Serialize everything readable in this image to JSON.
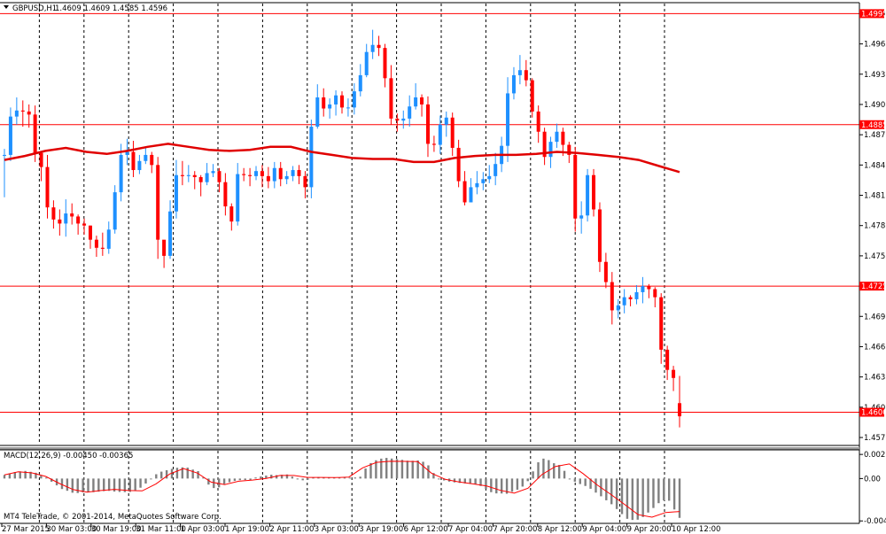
{
  "header": {
    "symbol_label": "GBPUSD,H1",
    "ohlc_label": "1.4609 1.4609 1.4585 1.4596"
  },
  "macd_header": {
    "label": "MACD(12,26,9) -0.00450 -0.00365"
  },
  "copyright": "MT4 TeleTrade, © 2001-2014, MetaQuotes Software Corp.",
  "colors": {
    "bull": "#1e90ff",
    "bear": "#ff0000",
    "ma": "#e00000",
    "hline": "#ff0000",
    "grid": "#000000",
    "hist": "#808080",
    "signal": "#ff0000"
  },
  "chart_data": [
    {
      "type": "candlestick",
      "title": "GBPUSD,H1",
      "timeframe": "H1",
      "grid": true,
      "y_axis_ticks": [
        "1.4995",
        "1.4965",
        "1.4935",
        "1.4905",
        "1.4875",
        "1.4845",
        "1.4815",
        "1.4785",
        "1.4755",
        "1.4725",
        "1.4695",
        "1.4665",
        "1.4635",
        "1.4605",
        "1.4575"
      ],
      "ylim": [
        1.4568,
        1.5005
      ],
      "x_axis_labels": [
        "27 Mar 2015",
        "30 Mar 03:00",
        "30 Mar 19:00",
        "31 Mar 11:00",
        "1 Apr 03:00",
        "1 Apr 19:00",
        "2 Apr 11:00",
        "3 Apr 03:00",
        "3 Apr 19:00",
        "6 Apr 12:00",
        "7 Apr 04:00",
        "7 Apr 20:00",
        "8 Apr 12:00",
        "9 Apr 04:00",
        "9 Apr 20:00",
        "10 Apr 12:00"
      ],
      "horizontal_lines": [
        {
          "label": "1.4995",
          "value": 1.4995
        },
        {
          "label": "1.4885",
          "value": 1.4885
        },
        {
          "label": "1.4725",
          "value": 1.4725
        },
        {
          "label": "1.4600",
          "value": 1.46
        }
      ],
      "series": [
        {
          "name": "GBPUSD",
          "candles_close": [
            1.4855,
            1.4893,
            1.4899,
            1.4898,
            1.4895,
            1.4857,
            1.4843,
            1.4803,
            1.4791,
            1.4787,
            1.4797,
            1.4794,
            1.4787,
            1.4785,
            1.4771,
            1.4763,
            1.4762,
            1.4781,
            1.4818,
            1.4855,
            1.4858,
            1.484,
            1.4849,
            1.4855,
            1.4845,
            1.4771,
            1.4755,
            1.4799,
            1.4835,
            1.4834,
            1.4835,
            1.4833,
            1.4828,
            1.4837,
            1.4839,
            1.4828,
            1.4804,
            1.4789,
            1.4836,
            1.4835,
            1.4834,
            1.4839,
            1.4834,
            1.4829,
            1.4842,
            1.4831,
            1.4834,
            1.484,
            1.4834,
            1.4823,
            1.4883,
            1.4912,
            1.4901,
            1.4905,
            1.4914,
            1.4902,
            1.4902,
            1.4918,
            1.4934,
            1.4957,
            1.4964,
            1.4961,
            1.4931,
            1.4891,
            1.4889,
            1.4891,
            1.4903,
            1.4912,
            1.4905,
            1.4866,
            1.4865,
            1.4885,
            1.4892,
            1.4862,
            1.4829,
            1.4808,
            1.4823,
            1.4827,
            1.4831,
            1.4834,
            1.4846,
            1.4864,
            1.4916,
            1.4934,
            1.4939,
            1.4929,
            1.4898,
            1.4878,
            1.4853,
            1.4868,
            1.4878,
            1.4865,
            1.4855,
            1.4792,
            1.4795,
            1.4835,
            1.4801,
            1.4749,
            1.4729,
            1.4701,
            1.4706,
            1.4714,
            1.4712,
            1.4719,
            1.4725,
            1.4722,
            1.4714,
            1.4662,
            1.4642,
            1.4634,
            1.4596
          ],
          "candles_range": [
            [
              1.4813,
              1.4861
            ],
            [
              1.4849,
              1.4902
            ],
            [
              1.4885,
              1.4912
            ],
            [
              1.4883,
              1.4909
            ],
            [
              1.4882,
              1.4905
            ],
            [
              1.4848,
              1.4904
            ],
            [
              1.4829,
              1.4858
            ],
            [
              1.4792,
              1.4855
            ],
            [
              1.4782,
              1.481
            ],
            [
              1.4775,
              1.4801
            ],
            [
              1.4774,
              1.4811
            ],
            [
              1.4786,
              1.4807
            ],
            [
              1.4776,
              1.4796
            ],
            [
              1.4776,
              1.4792
            ],
            [
              1.4762,
              1.4785
            ],
            [
              1.4754,
              1.4775
            ],
            [
              1.4755,
              1.4778
            ],
            [
              1.4757,
              1.4789
            ],
            [
              1.4777,
              1.4825
            ],
            [
              1.4809,
              1.4866
            ],
            [
              1.4845,
              1.4871
            ],
            [
              1.4833,
              1.4869
            ],
            [
              1.4836,
              1.4855
            ],
            [
              1.4846,
              1.4863
            ],
            [
              1.4837,
              1.4858
            ],
            [
              1.4752,
              1.4853
            ],
            [
              1.4743,
              1.4769
            ],
            [
              1.4752,
              1.481
            ],
            [
              1.4792,
              1.485
            ],
            [
              1.4825,
              1.4849
            ],
            [
              1.4828,
              1.4845
            ],
            [
              1.4821,
              1.4839
            ],
            [
              1.4814,
              1.4835
            ],
            [
              1.4825,
              1.4847
            ],
            [
              1.4833,
              1.4846
            ],
            [
              1.4818,
              1.4842
            ],
            [
              1.4795,
              1.4837
            ],
            [
              1.478,
              1.4807
            ],
            [
              1.4785,
              1.4847
            ],
            [
              1.4829,
              1.4842
            ],
            [
              1.4824,
              1.4842
            ],
            [
              1.483,
              1.4844
            ],
            [
              1.4823,
              1.4845
            ],
            [
              1.4822,
              1.4843
            ],
            [
              1.4822,
              1.4848
            ],
            [
              1.4824,
              1.4848
            ],
            [
              1.4826,
              1.4839
            ],
            [
              1.4829,
              1.4844
            ],
            [
              1.4826,
              1.4845
            ],
            [
              1.4812,
              1.4839
            ],
            [
              1.4812,
              1.489
            ],
            [
              1.4881,
              1.4925
            ],
            [
              1.4893,
              1.4921
            ],
            [
              1.4891,
              1.4911
            ],
            [
              1.4894,
              1.4919
            ],
            [
              1.4896,
              1.4918
            ],
            [
              1.4893,
              1.4911
            ],
            [
              1.4895,
              1.4926
            ],
            [
              1.4913,
              1.4945
            ],
            [
              1.4932,
              1.4965
            ],
            [
              1.495,
              1.4979
            ],
            [
              1.4953,
              1.4973
            ],
            [
              1.4922,
              1.4965
            ],
            [
              1.4885,
              1.4944
            ],
            [
              1.4878,
              1.4896
            ],
            [
              1.4881,
              1.4899
            ],
            [
              1.4883,
              1.4914
            ],
            [
              1.49,
              1.4926
            ],
            [
              1.4893,
              1.4915
            ],
            [
              1.4853,
              1.4913
            ],
            [
              1.4858,
              1.4874
            ],
            [
              1.4856,
              1.4894
            ],
            [
              1.4873,
              1.4898
            ],
            [
              1.4854,
              1.4897
            ],
            [
              1.4823,
              1.487
            ],
            [
              1.4805,
              1.4839
            ],
            [
              1.4813,
              1.4832
            ],
            [
              1.4816,
              1.4839
            ],
            [
              1.482,
              1.4838
            ],
            [
              1.4827,
              1.4845
            ],
            [
              1.4825,
              1.4857
            ],
            [
              1.4838,
              1.4873
            ],
            [
              1.4848,
              1.4932
            ],
            [
              1.491,
              1.4942
            ],
            [
              1.4925,
              1.4954
            ],
            [
              1.4923,
              1.4949
            ],
            [
              1.4892,
              1.4931
            ],
            [
              1.4867,
              1.4904
            ],
            [
              1.4845,
              1.4882
            ],
            [
              1.4842,
              1.4873
            ],
            [
              1.4862,
              1.4886
            ],
            [
              1.4854,
              1.4882
            ],
            [
              1.4847,
              1.4868
            ],
            [
              1.4779,
              1.4863
            ],
            [
              1.4777,
              1.4809
            ],
            [
              1.4789,
              1.4841
            ],
            [
              1.4794,
              1.4841
            ],
            [
              1.4739,
              1.4808
            ],
            [
              1.4723,
              1.4758
            ],
            [
              1.4687,
              1.4739
            ],
            [
              1.4693,
              1.4712
            ],
            [
              1.4698,
              1.4722
            ],
            [
              1.4705,
              1.4716
            ],
            [
              1.4707,
              1.4726
            ],
            [
              1.4708,
              1.4734
            ],
            [
              1.4713,
              1.4727
            ],
            [
              1.4704,
              1.4724
            ],
            [
              1.4648,
              1.4718
            ],
            [
              1.4632,
              1.4666
            ],
            [
              1.4621,
              1.4646
            ],
            [
              1.4585,
              1.4636
            ]
          ],
          "last_candle_ohlc": [
            1.4609,
            1.4609,
            1.4585,
            1.4596
          ]
        },
        {
          "name": "moving average",
          "values": [
            1.485,
            1.4854,
            1.4859,
            1.4862,
            1.4858,
            1.4856,
            1.4859,
            1.4863,
            1.4866,
            1.4863,
            1.486,
            1.4859,
            1.486,
            1.4863,
            1.4863,
            1.4858,
            1.4855,
            1.4852,
            1.4851,
            1.4851,
            1.4848,
            1.4848,
            1.4852,
            1.4854,
            1.4855,
            1.4855,
            1.4856,
            1.4858,
            1.4857,
            1.4855,
            1.4853,
            1.485,
            1.4844,
            1.4838
          ]
        }
      ]
    },
    {
      "type": "bar+line",
      "title": "MACD(12,26,9) -0.00450 -0.00365",
      "indicator": "MACD",
      "parameters": [
        12,
        26,
        9
      ],
      "grid": true,
      "y_axis_ticks": [
        "0.00276",
        "0.00",
        "-0.00485"
      ],
      "ylim": [
        -0.00503,
        0.00318
      ],
      "series": [
        {
          "name": "MACD",
          "values": [
            0.00041,
            0.00059,
            0.00074,
            0.00082,
            0.00087,
            0.00077,
            0.00066,
            0.00032,
            0.00011,
            -0.00036,
            -0.00078,
            -0.0012,
            -0.0014,
            -0.00162,
            -0.00166,
            -0.00158,
            -0.00159,
            -0.00156,
            -0.0015,
            -0.00144,
            -0.00141,
            -0.00149,
            -0.00153,
            -0.00155,
            -0.00153,
            -0.00134,
            -0.00105,
            -0.00057,
            -9e-05,
            0.00049,
            0.00079,
            0.00095,
            0.00111,
            0.00123,
            0.00128,
            0.00125,
            0.00103,
            0.00085,
            0.00012,
            -0.00069,
            -0.00109,
            -0.00101,
            -0.00062,
            -0.00042,
            -0.00027,
            -0.00018,
            -0.00017,
            -0.00017,
            0.00012,
            0.00024,
            0.00034,
            0.00044,
            0.00039,
            0.00043,
            0.00047,
            0.00022,
            -4e-05,
            -0.0002,
            -0.00012,
            0.00013,
            0.00017,
            0.00011,
            0.00012,
            0.00014,
            0.00013,
            0.00012,
            0.00011,
            0.00012,
            0.00021,
            0.00115,
            0.00177,
            0.00209,
            0.00228,
            0.00236,
            0.00229,
            0.00223,
            0.00214,
            0.00204,
            0.00203,
            0.00207,
            0.00192,
            0.00151,
            0.00063,
            -3e-05,
            -0.00022,
            -0.00035,
            -0.00044,
            -0.0005,
            -0.00056,
            -0.0006,
            -0.00068,
            -0.00085,
            -0.00118,
            -0.00156,
            -0.0017,
            -0.00171,
            -0.00174,
            -0.00151,
            -0.00128,
            -0.00092,
            -0.0003,
            0.00082,
            0.00186,
            0.00228,
            0.00211,
            0.00175,
            0.00155,
            0.00088,
            -9e-05,
            -0.00036,
            -0.00063,
            -0.00085,
            -0.00117,
            -0.00161,
            -0.00203,
            -0.00249,
            -0.00294,
            -0.00349,
            -0.00407,
            -0.00461,
            -0.00474,
            -0.00471,
            -0.0044,
            -0.00389,
            -0.00337,
            -0.00282,
            -0.0025,
            -0.00254,
            -0.00354,
            -0.0045
          ]
        },
        {
          "name": "signal",
          "values": [
            0.00042,
            0.00077,
            0.00065,
            0.00024,
            -0.00057,
            -0.00127,
            -0.00156,
            -0.00137,
            -0.00124,
            -0.00137,
            -0.00141,
            -0.00061,
            0.00052,
            0.00114,
            0.00063,
            -0.00041,
            -0.00069,
            -0.00031,
            -0.00018,
            2e-05,
            0.00035,
            0.00035,
            0.00013,
            0.00013,
            0.00011,
            0.00017,
            0.00122,
            0.00185,
            0.00197,
            0.00196,
            0.00194,
            0.00061,
            -9e-05,
            -0.0004,
            -0.00061,
            -0.00085,
            -0.00135,
            -0.00168,
            -0.00111,
            0.00044,
            0.00139,
            0.00167,
            0.00056,
            -0.00071,
            -0.0018,
            -0.00295,
            -0.00414,
            -0.00442,
            -0.00388,
            -0.00377
          ]
        }
      ]
    }
  ]
}
